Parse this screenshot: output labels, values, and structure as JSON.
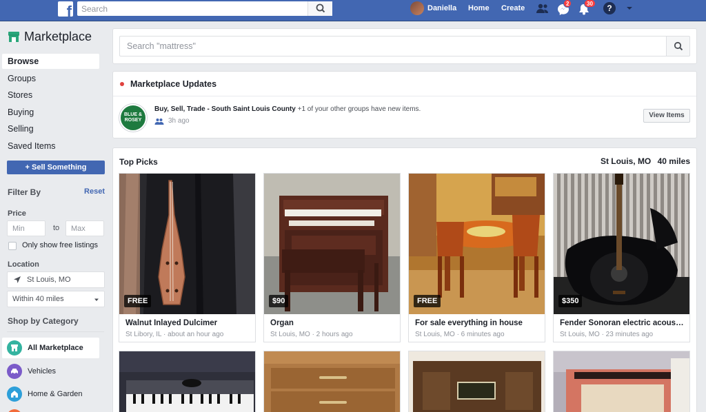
{
  "topbar": {
    "search_placeholder": "Search",
    "user_name": "Daniella",
    "home": "Home",
    "create": "Create",
    "messages_badge": "2",
    "notifications_badge": "30",
    "help": "?"
  },
  "sidebar": {
    "title": "Marketplace",
    "nav": [
      "Browse",
      "Groups",
      "Stores",
      "Buying",
      "Selling",
      "Saved Items"
    ],
    "sell_button": "+ Sell Something",
    "filter_by": "Filter By",
    "reset": "Reset",
    "price_label": "Price",
    "min_placeholder": "Min",
    "to": "to",
    "max_placeholder": "Max",
    "free_only": "Only show free listings",
    "location_label": "Location",
    "location_value": "St Louis, MO",
    "radius_value": "Within 40 miles",
    "shop_by_category": "Shop by Category",
    "categories": [
      "All Marketplace",
      "Vehicles",
      "Home & Garden"
    ]
  },
  "main": {
    "search_placeholder": "Search \"mattress\"",
    "updates": {
      "title": "Marketplace Updates",
      "group_name": "Buy, Sell, Trade - South Saint Louis County",
      "group_suffix": " +1 of your other groups have new items.",
      "time": "3h ago",
      "button": "View Items",
      "avatar_text": "BLUE & ROSEY"
    },
    "picks": {
      "title": "Top Picks",
      "location": "St Louis, MO",
      "distance": "40 miles",
      "items": [
        {
          "price": "FREE",
          "name": "Walnut Inlayed Dulcimer",
          "meta": "St Libory, IL · about an hour ago"
        },
        {
          "price": "$90",
          "name": "Organ",
          "meta": "St Louis, MO · 2 hours ago"
        },
        {
          "price": "FREE",
          "name": "For sale everything in house",
          "meta": "St Louis, MO · 6 minutes ago"
        },
        {
          "price": "$350",
          "name": "Fender Sonoran electric acousti…",
          "meta": "St Louis, MO · 23 minutes ago"
        }
      ]
    }
  },
  "colors": {
    "brand": "#4267b2",
    "badge": "#fa3e3e",
    "background": "#e9ebee"
  }
}
